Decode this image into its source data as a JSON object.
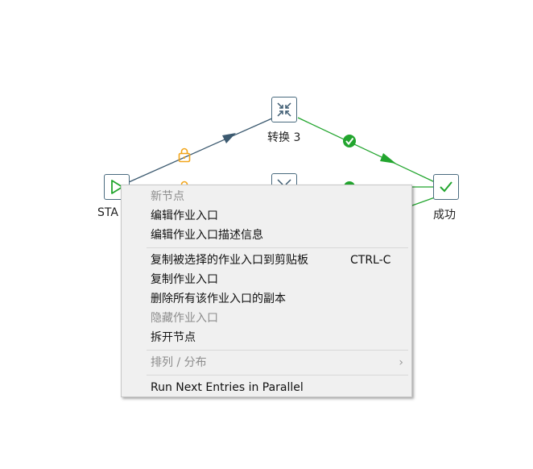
{
  "canvas": {
    "nodes": {
      "start": {
        "label": "STA",
        "icon": "play-triangle-icon"
      },
      "transform3": {
        "label": "转换 3",
        "icon": "compress-arrows-icon"
      },
      "transform_hidden": {
        "icon": "compress-arrows-icon"
      },
      "success": {
        "label": "成功",
        "icon": "checkmark-icon"
      }
    },
    "hop_colors": {
      "unconditional": "#3c5a70",
      "success": "#22a52e",
      "lock": "#f2a51a"
    }
  },
  "context_menu": {
    "header": "新节点",
    "edit_entry": "编辑作业入口",
    "edit_entry_description": "编辑作业入口描述信息",
    "copy_selected_to_clipboard": "复制被选择的作业入口到剪贴板",
    "copy_shortcut": "CTRL-C",
    "duplicate_entry": "复制作业入口",
    "delete_all_copies": "删除所有该作业入口的副本",
    "hide_entry": "隐藏作业入口",
    "detach_node": "拆开节点",
    "align_distribute": "排列 / 分布",
    "submenu_arrow": "›",
    "run_next_parallel": "Run Next Entries in Parallel"
  }
}
